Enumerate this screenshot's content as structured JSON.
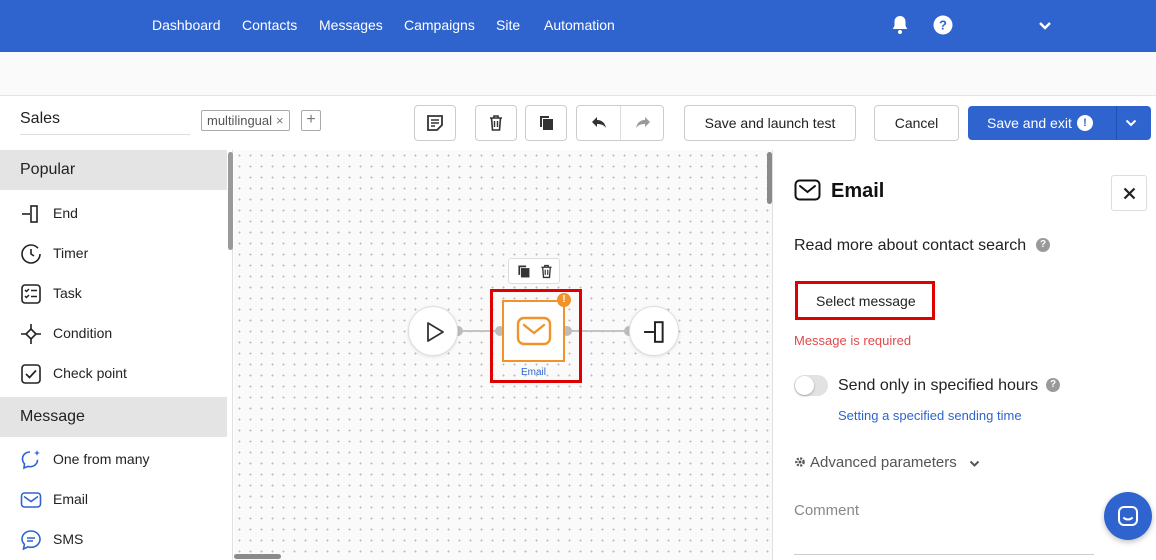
{
  "nav": {
    "items": [
      "Dashboard",
      "Contacts",
      "Messages",
      "Campaigns",
      "Site",
      "Automation"
    ],
    "icons": [
      "bell-icon",
      "help-icon",
      "chevron-down-icon"
    ]
  },
  "toolbar": {
    "workflow_name": "Sales",
    "tag": "multilingual",
    "tag_remove": "×",
    "tag_add": "+",
    "save_test_label": "Save and launch test",
    "cancel_label": "Cancel",
    "save_exit_label": "Save and exit",
    "save_exit_warning": "!",
    "icons": [
      "note-icon",
      "trash-icon",
      "copy-icon",
      "undo-icon",
      "redo-icon",
      "chevron-down-icon"
    ]
  },
  "palette": {
    "sections": [
      {
        "title": "Popular",
        "items": [
          {
            "label": "End",
            "icon": "end-icon"
          },
          {
            "label": "Timer",
            "icon": "timer-icon"
          },
          {
            "label": "Task",
            "icon": "task-icon"
          },
          {
            "label": "Condition",
            "icon": "condition-icon"
          },
          {
            "label": "Check point",
            "icon": "checkpoint-icon"
          }
        ]
      },
      {
        "title": "Message",
        "items": [
          {
            "label": "One from many",
            "icon": "sparkle-chat-icon"
          },
          {
            "label": "Email",
            "icon": "email-icon"
          },
          {
            "label": "SMS",
            "icon": "sms-icon"
          }
        ]
      }
    ]
  },
  "canvas": {
    "email_node_label": "Email",
    "node_warning": "!",
    "accent": "#f0932b"
  },
  "panel": {
    "title": "Email",
    "read_more": "Read more about contact search",
    "select_message": "Select message",
    "error": "Message is required",
    "send_hours_label": "Send only in specified hours",
    "send_hours_link": "Setting a specified sending time",
    "advanced": "Advanced parameters",
    "comment_placeholder": "Comment",
    "help_glyph": "?"
  },
  "colors": {
    "primary": "#2f64cf",
    "error": "#e04a4a",
    "highlight": "#e00000"
  }
}
